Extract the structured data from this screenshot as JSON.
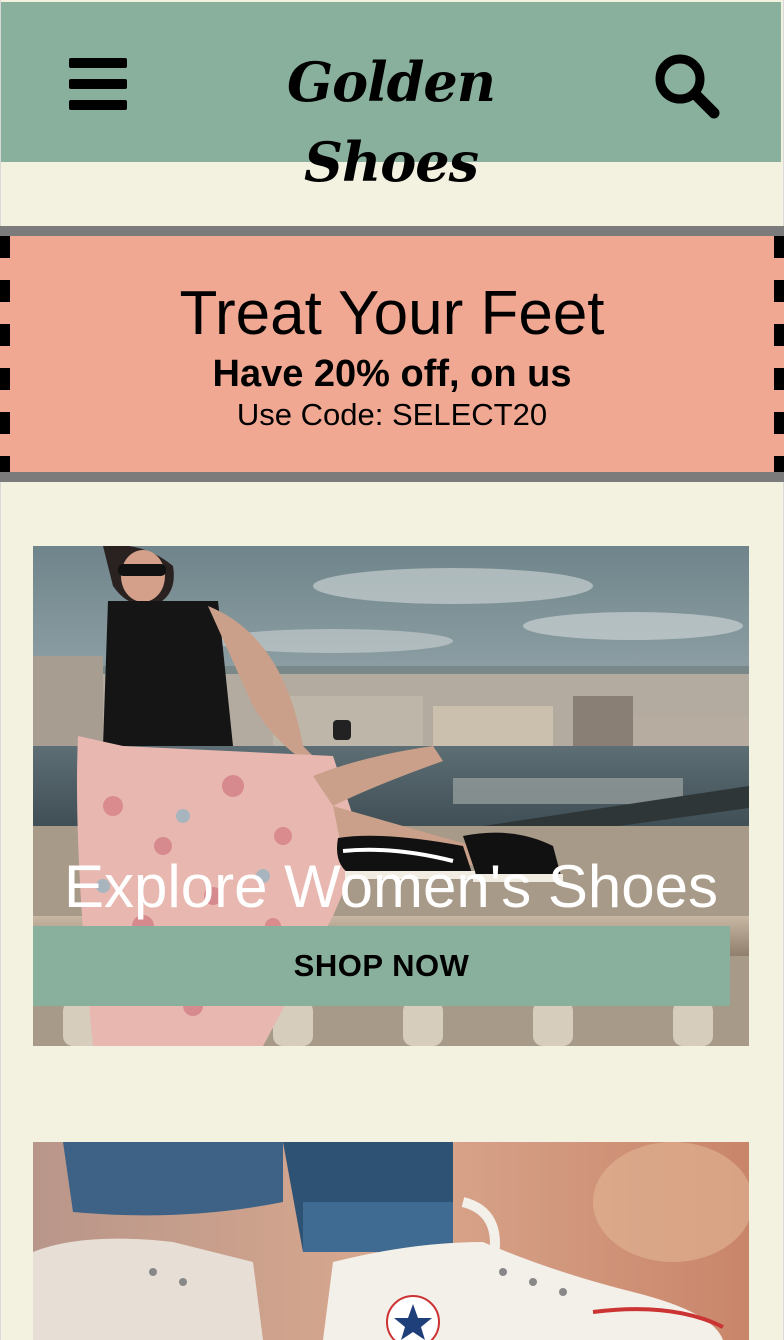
{
  "header": {
    "menu_icon": "hamburger-menu-icon",
    "brand": "Golden Shoes",
    "search_icon": "search-icon",
    "background": "#89b09c"
  },
  "promo": {
    "headline": "Treat Your Feet",
    "offer": "Have 20% off, on us",
    "code_text": "Use Code: SELECT20",
    "background": "#f0a893"
  },
  "featured": [
    {
      "title": "Explore Women's Shoes",
      "button_label": "SHOP NOW"
    }
  ],
  "colors": {
    "page_background": "#f3f1e0",
    "accent_green": "#89b09c",
    "promo_pink": "#f0a893"
  }
}
